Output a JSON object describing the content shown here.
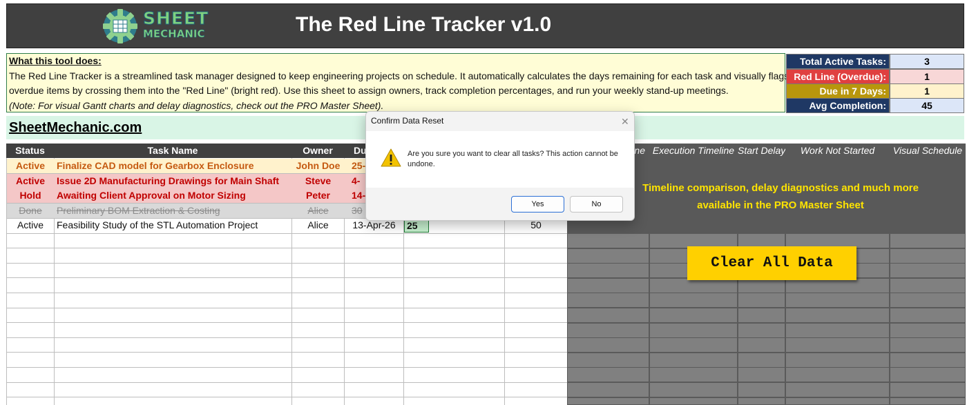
{
  "header": {
    "logo_line1": "SHEET",
    "logo_line2": "MECHANIC",
    "title": "The Red Line Tracker v1.0",
    "logo_icon": "gear-icon"
  },
  "description": {
    "heading": "What this tool does:",
    "line1": "The Red Line Tracker is a streamlined task manager designed to keep engineering projects on schedule. It automatically calculates the days remaining for each task and visually flags",
    "line2": "overdue items by crossing them into the \"Red Line\" (bright red). Use this sheet to assign owners, track completion percentages, and run your weekly stand-up meetings.",
    "note": "(Note: For visual Gantt charts and delay diagnostics, check out the PRO Master Sheet)."
  },
  "stats": [
    {
      "label": "Total Active Tasks:",
      "value": "3",
      "label_bg": "#1f3864",
      "label_color": "#ffffff",
      "value_bg": "#dce6f8"
    },
    {
      "label": "Red Line (Overdue):",
      "value": "1",
      "label_bg": "#e04040",
      "label_color": "#ffffff",
      "value_bg": "#f8d7d7"
    },
    {
      "label": "Due in 7 Days:",
      "value": "1",
      "label_bg": "#b8960c",
      "label_color": "#ffffff",
      "value_bg": "#fff2cc"
    },
    {
      "label": "Avg Completion:",
      "value": "45",
      "label_bg": "#1f3864",
      "label_color": "#ffffff",
      "value_bg": "#dce6f8"
    }
  ],
  "site_link": "SheetMechanic.com",
  "table": {
    "headers": [
      "Status",
      "Task Name",
      "Owner",
      "Du"
    ],
    "rows": [
      {
        "status": "Active",
        "task": "Finalize CAD model for Gearbox Enclosure",
        "owner": "John Doe",
        "due": "25-",
        "pct": "",
        "days": "",
        "style": "due"
      },
      {
        "status": "Active",
        "task": "Issue 2D Manufacturing Drawings for Main Shaft",
        "owner": "Steve",
        "due": "4-",
        "pct": "",
        "days": "",
        "style": "overdue"
      },
      {
        "status": "Hold",
        "task": "Awaiting Client Approval on Motor Sizing",
        "owner": "Peter",
        "due": "14-",
        "pct": "",
        "days": "",
        "style": "overdue"
      },
      {
        "status": "Done",
        "task": "Preliminary BOM Extraction & Costing",
        "owner": "Alice",
        "due": "30",
        "pct": "",
        "days": "",
        "style": "done"
      },
      {
        "status": "Active",
        "task": "Feasibility Study of the STL Automation Project",
        "owner": "Alice",
        "due": "13-Apr-26",
        "pct": "25",
        "days": "50",
        "style": "normal"
      }
    ]
  },
  "pro": {
    "headers": [
      "ne",
      "Execution Timeline",
      "Start Delay",
      "Work Not Started",
      "Visual Schedule"
    ],
    "message_line1": "Timeline comparison, delay diagnostics and much more",
    "message_line2": "available in the PRO Master Sheet",
    "clear_button": "Clear All Data"
  },
  "dialog": {
    "title": "Confirm Data Reset",
    "message": "Are you sure you want to clear all tasks? This action cannot be undone.",
    "yes": "Yes",
    "no": "No",
    "close_glyph": "✕",
    "warning_icon": "warning-icon"
  },
  "colors": {
    "header_bg": "#404040",
    "due_row": "#fff2cc",
    "due_text": "#c55a11",
    "overdue_row": "#f4c7c7",
    "overdue_text": "#c00000",
    "done_row": "#d9d9d9",
    "done_text": "#8c8c8c",
    "pro_text": "#ffe400",
    "clear_button_bg": "#ffd000"
  }
}
